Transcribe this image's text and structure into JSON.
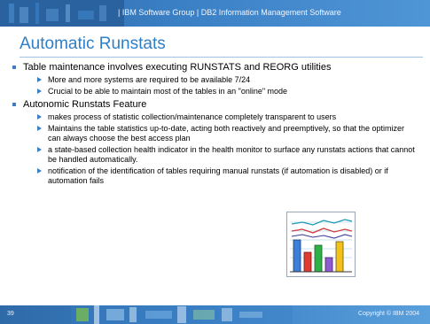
{
  "header": {
    "text": "| IBM Software Group  |  DB2 Information Management Software"
  },
  "title": "Automatic Runstats",
  "bullets": [
    {
      "text": "Table maintenance involves executing RUNSTATS and REORG utilities",
      "sub": [
        "More and more systems are required to be available 7/24",
        "Crucial to be able to maintain most of the tables in an \"online\" mode"
      ]
    },
    {
      "text": "Autonomic Runstats Feature",
      "sub": [
        "makes process of statistic collection/maintenance completely transparent to users",
        "Maintains the table statistics up-to-date, acting both reactively and preemptively, so that the optimizer can always choose the best access plan",
        "a state-based collection health indicator in the health monitor to surface any runstats actions that cannot be handled automatically.",
        "notification of the identification of tables requiring manual runstats (if automation is disabled) or if automation fails"
      ]
    }
  ],
  "footer": {
    "page_number": "39",
    "copyright": "Copyright © IBM 2004"
  },
  "clipart": {
    "icon": "bar-chart-clipart-icon",
    "bar_colors": [
      "#3b7fd9",
      "#e03b2f",
      "#2fb14a",
      "#8e5bd1",
      "#f2c21b"
    ]
  },
  "colors": {
    "brand_blue": "#3a7fc4",
    "title_blue": "#2f7fc6"
  }
}
